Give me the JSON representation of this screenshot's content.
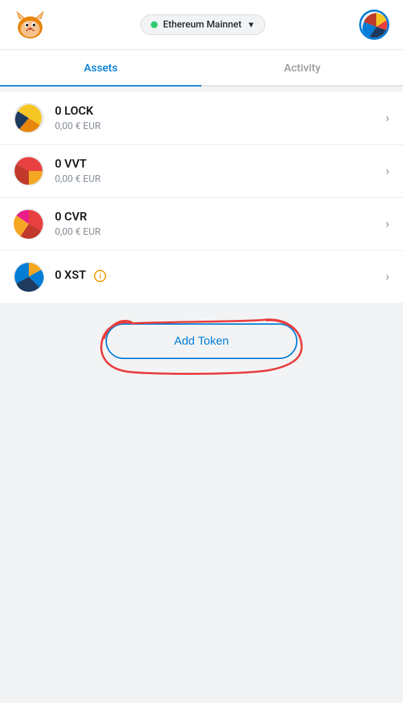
{
  "header": {
    "network": "Ethereum Mainnet",
    "network_dot_color": "#2ecc71"
  },
  "tabs": [
    {
      "id": "assets",
      "label": "Assets",
      "active": true
    },
    {
      "id": "activity",
      "label": "Activity",
      "active": false
    }
  ],
  "tokens": [
    {
      "id": "lock",
      "symbol": "LOCK",
      "amount": "0 LOCK",
      "value": "0,00 € EUR",
      "has_info": false
    },
    {
      "id": "vvt",
      "symbol": "VVT",
      "amount": "0 VVT",
      "value": "0,00 € EUR",
      "has_info": false
    },
    {
      "id": "cvr",
      "symbol": "CVR",
      "amount": "0 CVR",
      "value": "0,00 € EUR",
      "has_info": false
    },
    {
      "id": "xst",
      "symbol": "XST",
      "amount": "0 XST",
      "value": "",
      "has_info": true
    }
  ],
  "add_token_button": "Add Token",
  "info_badge_label": "i"
}
